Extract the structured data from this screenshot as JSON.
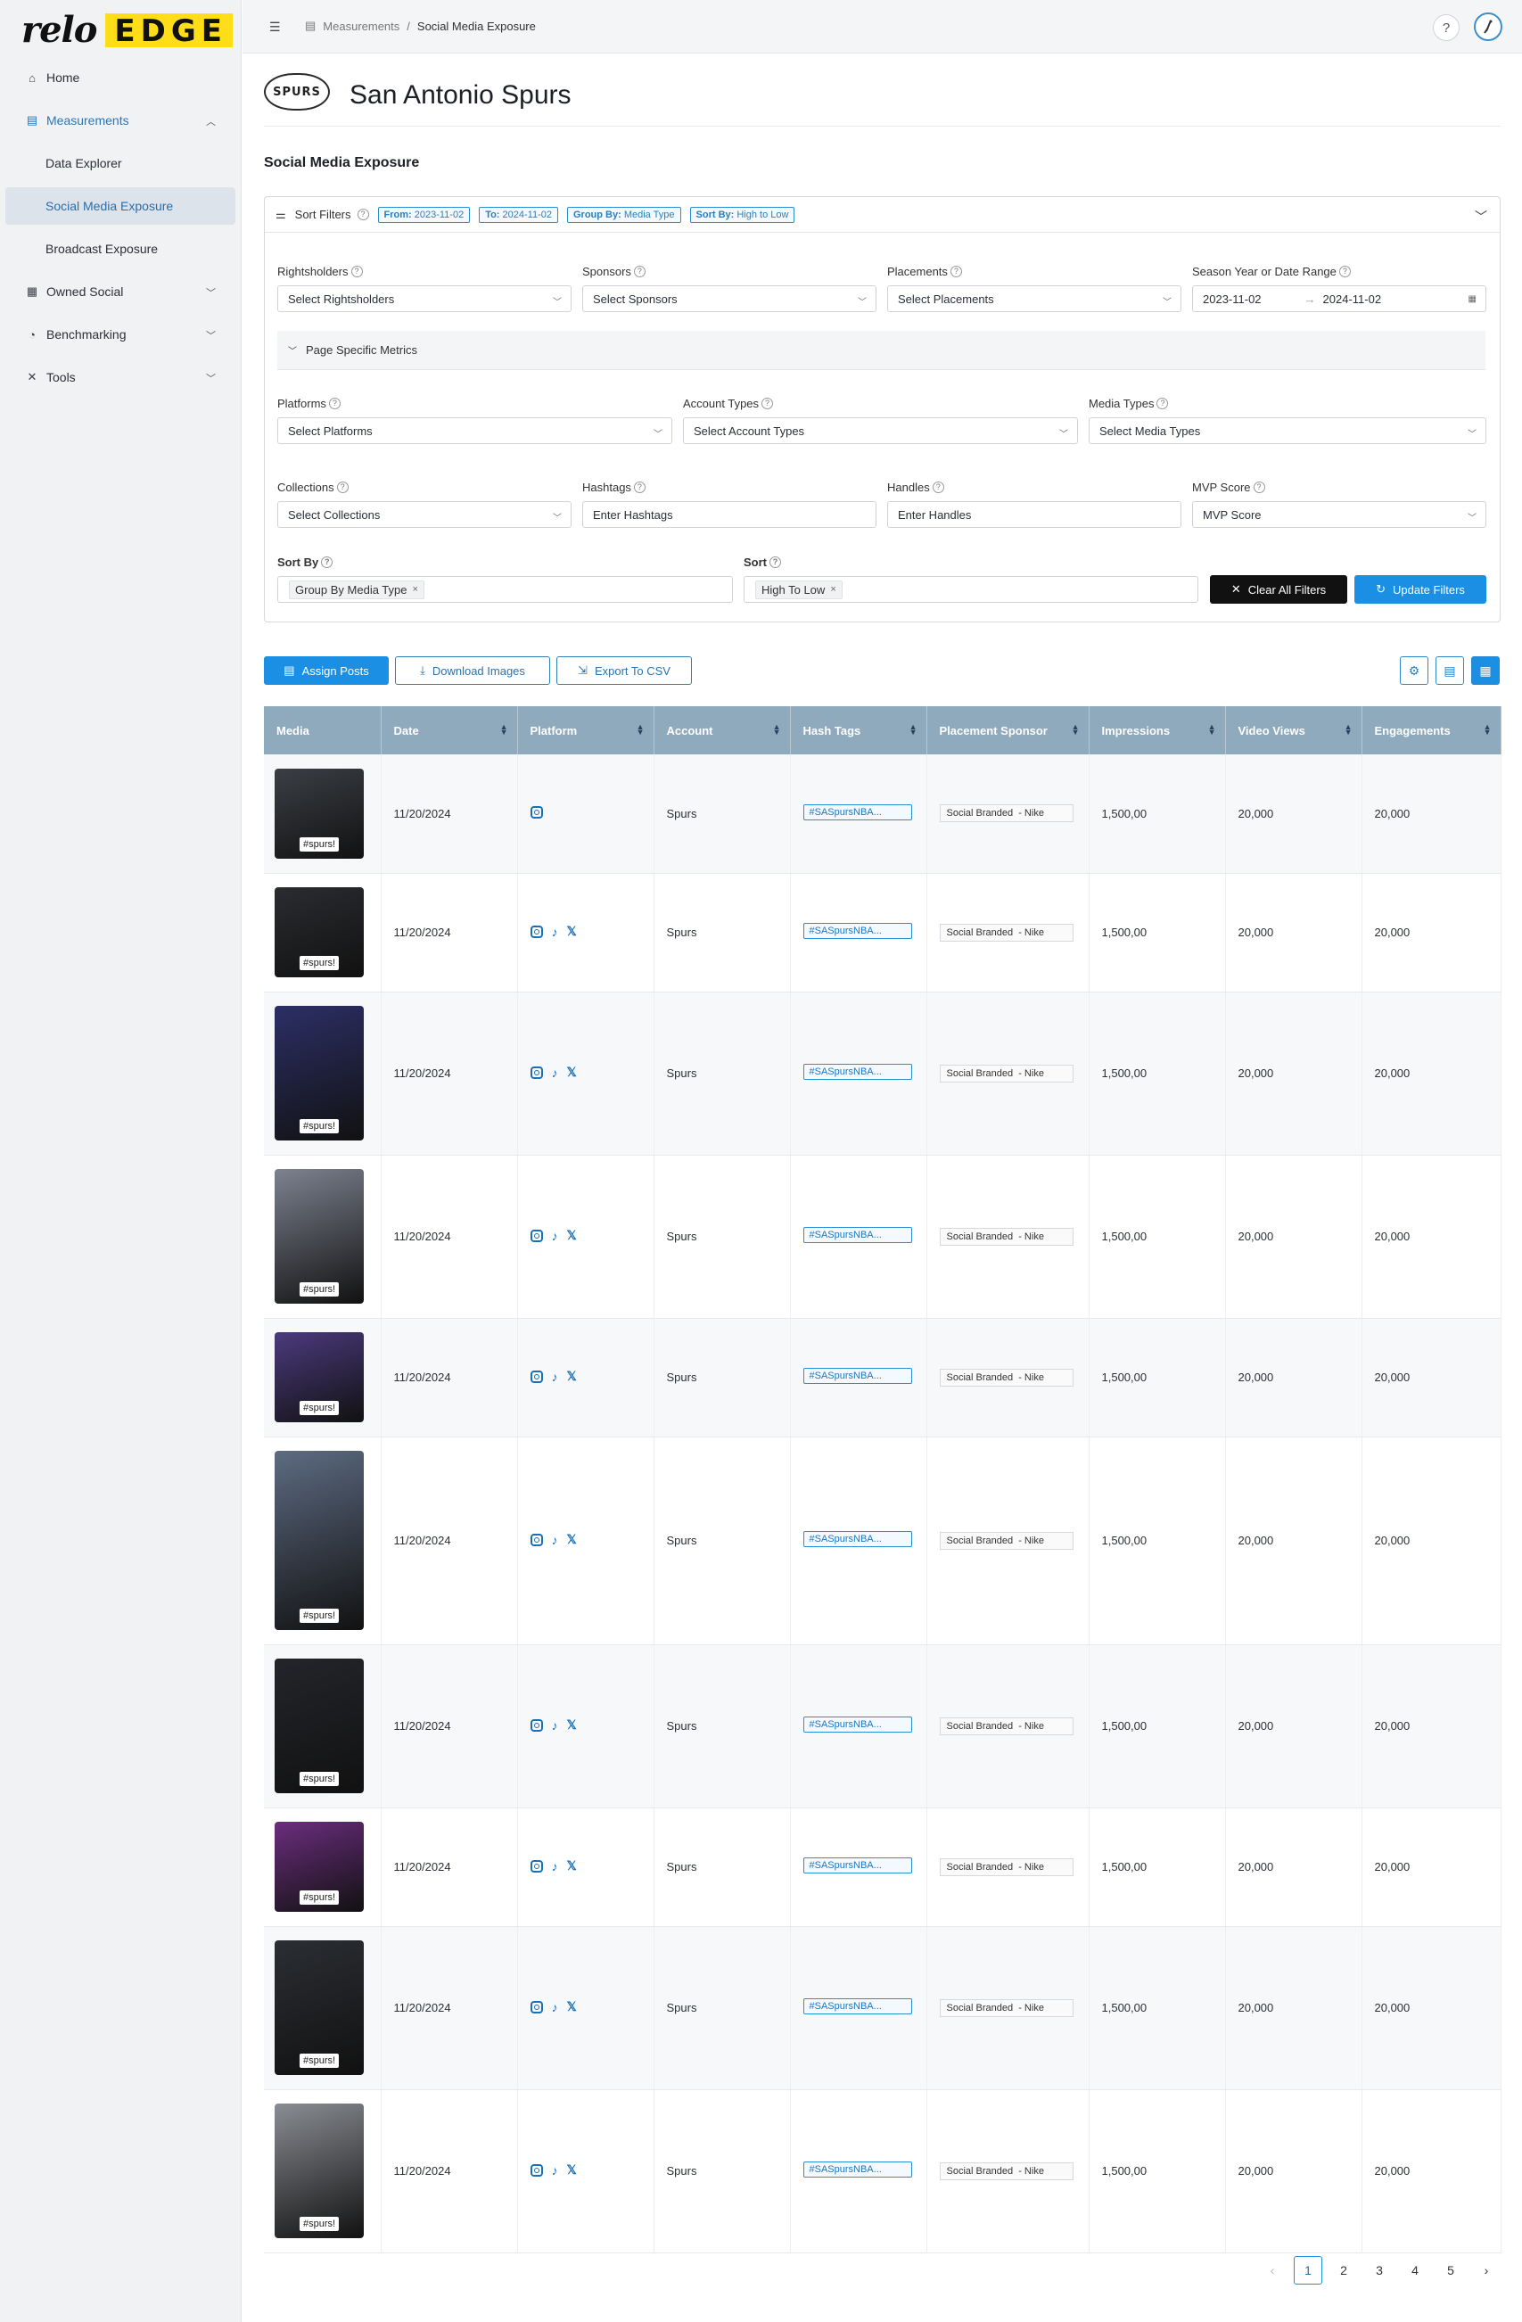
{
  "brand": {
    "relo": "relo",
    "edge": "EDGE"
  },
  "sidebar": {
    "items": [
      {
        "label": "Home",
        "icon": "home-icon"
      },
      {
        "label": "Measurements",
        "icon": "measurements-icon"
      },
      {
        "label": "Owned Social",
        "icon": "grid-icon"
      },
      {
        "label": "Benchmarking",
        "icon": "pie-chart-icon"
      },
      {
        "label": "Tools",
        "icon": "tools-icon"
      }
    ],
    "sub_items": [
      "Data Explorer",
      "Social Media Exposure",
      "Broadcast Exposure"
    ]
  },
  "topbar": {
    "crumb_parent": "Measurements",
    "crumb_sep": "/",
    "crumb_current": "Social Media Exposure",
    "help": "?"
  },
  "team": {
    "logo_text": "SPURS",
    "name": "San Antonio Spurs"
  },
  "section_title": "Social Media Exposure",
  "filters": {
    "title": "Sort Filters",
    "chips": [
      {
        "key": "From:",
        "value": "2023-11-02"
      },
      {
        "key": "To:",
        "value": "2024-11-02"
      },
      {
        "key": "Group By:",
        "value": "Media Type"
      },
      {
        "key": "Sort By:",
        "value": "High to Low"
      }
    ],
    "rightsholders": {
      "label": "Rightsholders",
      "value": "Select Rightsholders"
    },
    "sponsors": {
      "label": "Sponsors",
      "value": "Select Sponsors"
    },
    "placements": {
      "label": "Placements",
      "value": "Select Placements"
    },
    "date_range": {
      "label": "Season Year or Date Range",
      "from": "2023-11-02",
      "to": "2024-11-02",
      "arrow": "→"
    },
    "page_specific": "Page Specific Metrics",
    "platforms": {
      "label": "Platforms",
      "value": "Select Platforms"
    },
    "account_types": {
      "label": "Account Types",
      "value": "Select Account Types"
    },
    "media_types": {
      "label": "Media Types",
      "value": "Select Media Types"
    },
    "collections": {
      "label": "Collections",
      "value": "Select Collections"
    },
    "hashtags": {
      "label": "Hashtags",
      "placeholder": "Enter Hashtags"
    },
    "handles": {
      "label": "Handles",
      "placeholder": "Enter Handles"
    },
    "mvp": {
      "label": "MVP Score",
      "value": "MVP Score"
    },
    "sort_by": {
      "label": "Sort By",
      "tag": "Group By Media Type"
    },
    "sort": {
      "label": "Sort",
      "tag": "High To Low"
    },
    "clear_label": "Clear All Filters",
    "update_label": "Update Filters"
  },
  "actions": {
    "assign": "Assign Posts",
    "download": "Download Images",
    "export": "Export To CSV"
  },
  "table": {
    "columns": [
      "Media",
      "Date",
      "Platform",
      "Account",
      "Hash Tags",
      "Placement Sponsor",
      "Impressions",
      "Video Views",
      "Engagements"
    ],
    "thumb_label": "#spurs!",
    "rows": [
      {
        "date": "11/20/2024",
        "platforms": [
          "instagram"
        ],
        "account": "Spurs",
        "hashtag": "#SASpursNBA...",
        "sponsor": "Social Branded  - Nike",
        "impressions": "1,500,00",
        "views": "20,000",
        "engagements": "20,000",
        "thumb_color": "#3b3f45"
      },
      {
        "date": "11/20/2024",
        "platforms": [
          "instagram",
          "tiktok",
          "x"
        ],
        "account": "Spurs",
        "hashtag": "#SASpursNBA...",
        "sponsor": "Social Branded  - Nike",
        "impressions": "1,500,00",
        "views": "20,000",
        "engagements": "20,000",
        "thumb_color": "#2a2c30"
      },
      {
        "date": "11/20/2024",
        "platforms": [
          "instagram",
          "tiktok",
          "x"
        ],
        "account": "Spurs",
        "hashtag": "#SASpursNBA...",
        "sponsor": "Social Branded  - Nike",
        "impressions": "1,500,00",
        "views": "20,000",
        "engagements": "20,000",
        "thumb_color": "#2c2f66"
      },
      {
        "date": "11/20/2024",
        "platforms": [
          "instagram",
          "tiktok",
          "x"
        ],
        "account": "Spurs",
        "hashtag": "#SASpursNBA...",
        "sponsor": "Social Branded  - Nike",
        "impressions": "1,500,00",
        "views": "20,000",
        "engagements": "20,000",
        "thumb_color": "#7d8290"
      },
      {
        "date": "11/20/2024",
        "platforms": [
          "instagram",
          "tiktok",
          "x"
        ],
        "account": "Spurs",
        "hashtag": "#SASpursNBA...",
        "sponsor": "Social Branded  - Nike",
        "impressions": "1,500,00",
        "views": "20,000",
        "engagements": "20,000",
        "thumb_color": "#4b3a7e"
      },
      {
        "date": "11/20/2024",
        "platforms": [
          "instagram",
          "tiktok",
          "x"
        ],
        "account": "Spurs",
        "hashtag": "#SASpursNBA...",
        "sponsor": "Social Branded  - Nike",
        "impressions": "1,500,00",
        "views": "20,000",
        "engagements": "20,000",
        "thumb_color": "#5d6b82"
      },
      {
        "date": "11/20/2024",
        "platforms": [
          "instagram",
          "tiktok",
          "x"
        ],
        "account": "Spurs",
        "hashtag": "#SASpursNBA...",
        "sponsor": "Social Branded  - Nike",
        "impressions": "1,500,00",
        "views": "20,000",
        "engagements": "20,000",
        "thumb_color": "#23252a"
      },
      {
        "date": "11/20/2024",
        "platforms": [
          "instagram",
          "tiktok",
          "x"
        ],
        "account": "Spurs",
        "hashtag": "#SASpursNBA...",
        "sponsor": "Social Branded  - Nike",
        "impressions": "1,500,00",
        "views": "20,000",
        "engagements": "20,000",
        "thumb_color": "#6b2d7e"
      },
      {
        "date": "11/20/2024",
        "platforms": [
          "instagram",
          "tiktok",
          "x"
        ],
        "account": "Spurs",
        "hashtag": "#SASpursNBA...",
        "sponsor": "Social Branded  - Nike",
        "impressions": "1,500,00",
        "views": "20,000",
        "engagements": "20,000",
        "thumb_color": "#2b2e33"
      },
      {
        "date": "11/20/2024",
        "platforms": [
          "instagram",
          "tiktok",
          "x"
        ],
        "account": "Spurs",
        "hashtag": "#SASpursNBA...",
        "sponsor": "Social Branded  - Nike",
        "impressions": "1,500,00",
        "views": "20,000",
        "engagements": "20,000",
        "thumb_color": "#8a8d93"
      }
    ]
  },
  "pagination": {
    "pages": [
      "1",
      "2",
      "3",
      "4",
      "5"
    ],
    "current": "1",
    "prev": "‹",
    "next": "›"
  },
  "colors": {
    "accent": "#1a8fe3",
    "header": "#8fa9bd",
    "brand_yellow": "#ffde17"
  }
}
